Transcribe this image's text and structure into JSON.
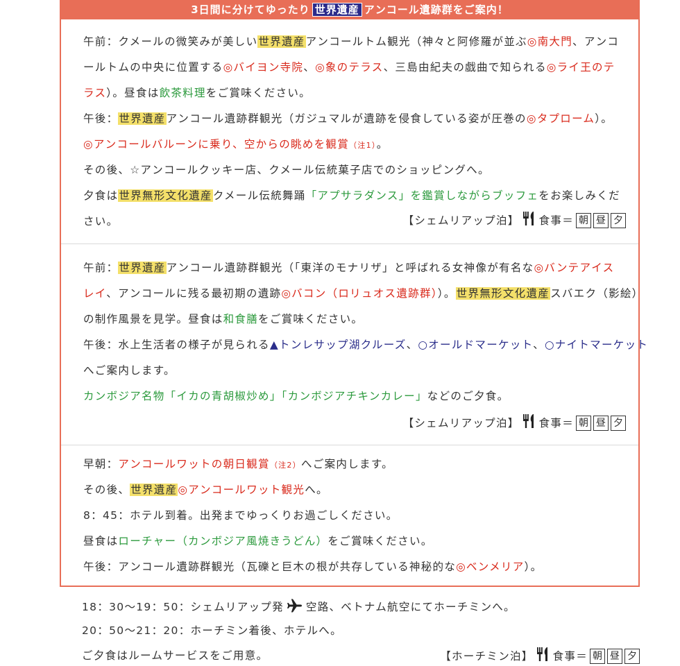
{
  "banner": {
    "pre": "3日間に分けてゆったり",
    "badge": "世界遺産",
    "post": "アンコール遺跡群をご案内！"
  },
  "day1": {
    "l1a": "午前：クメールの微笑みが美しい",
    "l1b": "世界遺産",
    "l1c": "アンコールトム観光（神々と阿修羅が並ぶ",
    "l1d": "◎南大門",
    "l1e": "、アンコ",
    "l2a": "ールトムの中央に位置する",
    "l2b": "◎バイヨン寺院",
    "l2c": "、",
    "l2d": "◎象のテラス",
    "l2e": "、三島由紀夫の戯曲で知られる",
    "l2f": "◎ライ王のテ",
    "l3a": "ラス",
    "l3b": "）。昼食は",
    "l3c": "飲茶料理",
    "l3d": "をご賞味ください。",
    "l4a": "午後：",
    "l4b": "世界遺産",
    "l4c": "アンコール遺跡群観光（ガジュマルが遺跡を侵食している姿が圧巻の",
    "l4d": "◎タプローム",
    "l4e": "）。",
    "l5a": "◎アンコールバルーンに乗り、空からの眺めを観賞",
    "l5b": "（注1）",
    "l5c": "。",
    "l6": "その後、☆アンコールクッキー店、クメール伝統菓子店でのショッピングへ。",
    "l7a": "夕食は",
    "l7b": "世界無形文化遺産",
    "l7c": "クメール伝統舞踊",
    "l7d": "「アプサラダンス」を鑑賞しながらブッフェ",
    "l7e": "をお楽しみくだ",
    "l8": "さい。",
    "stay": "【シェムリアップ泊】",
    "meal_label": "食事＝",
    "meals": [
      "朝",
      "昼",
      "夕"
    ]
  },
  "day2": {
    "l1a": "午前：",
    "l1b": "世界遺産",
    "l1c": "アンコール遺跡群観光（「東洋のモナリザ」と呼ばれる女神像が有名な",
    "l1d": "◎バンテアイス",
    "l2a": "レイ",
    "l2b": "、アンコールに残る最初期の遺跡",
    "l2c": "◎バコン（ロリュオス遺跡群）",
    "l2d": "）。",
    "l2e": "世界無形文化遺産",
    "l2f": "スバエク（影絵）",
    "l3a": "の制作風景を見学。昼食は",
    "l3b": "和食膳",
    "l3c": "をご賞味ください。",
    "l4a": "午後：水上生活者の様子が見られる",
    "l4b": "▲トンレサップ湖クルーズ",
    "l4c": "、",
    "l4d": "○オールドマーケット",
    "l4e": "、",
    "l4f": "○ナイトマーケット",
    "l5": "へご案内します。",
    "l6a": "カンボジア名物「イカの青胡椒炒め」「カンボジアチキンカレー」",
    "l6b": "などのご夕食。",
    "stay": "【シェムリアップ泊】",
    "meal_label": "食事＝",
    "meals": [
      "朝",
      "昼",
      "夕"
    ]
  },
  "day3": {
    "l1a": "早朝：",
    "l1b": "アンコールワットの朝日観賞",
    "l1c": "（注2）",
    "l1d": "へご案内します。",
    "l2a": "その後、",
    "l2b": "世界遺産",
    "l2c": "◎アンコールワット観光",
    "l2d": "へ。",
    "l3": "8：45：ホテル到着。出発までゆっくりお過ごしください。",
    "l4a": "昼食は",
    "l4b": "ローチャー（カンボジア風焼きうどん）",
    "l4c": "をご賞味ください。",
    "l5a": "午後：アンコール遺跡群観光（瓦礫と巨木の根が共存している神秘的な",
    "l5b": "◎ベンメリア",
    "l5c": "）。"
  },
  "after": {
    "l1a": "18：30〜19：50：シェムリアップ発",
    "l1b": "空路、ベトナム航空にてホーチミンへ。",
    "l2": "20：50〜21：20：ホーチミン着後、ホテルへ。",
    "l3": "ご夕食はルームサービスをご用意。",
    "stay": "【ホーチミン泊】",
    "meal_label": "食事＝",
    "meals": [
      "朝",
      "昼",
      "夕"
    ]
  },
  "colors": {
    "accent": "#e86e57",
    "badge": "#2b2a8a",
    "highlight": "#f4e06a",
    "red": "#d92a1c",
    "green": "#2c9a3d",
    "navy": "#2a2d8a"
  },
  "icons": {
    "meal": "fork-knife-icon",
    "flight": "airplane-icon"
  }
}
